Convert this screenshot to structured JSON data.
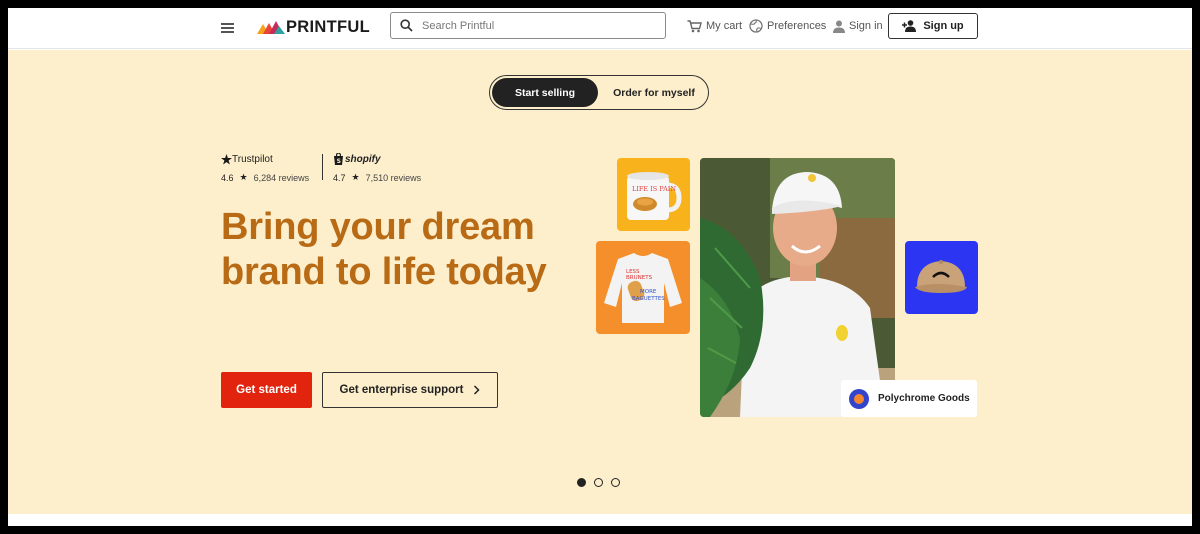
{
  "header": {
    "logo_text": "PRINTFUL",
    "search_placeholder": "Search Printful",
    "cart_label": "My cart",
    "preferences_label": "Preferences",
    "signin_label": "Sign in",
    "signup_label": "Sign up"
  },
  "hero": {
    "toggle": {
      "active": "Start selling",
      "inactive": "Order for myself"
    },
    "ratings": [
      {
        "brand": "Trustpilot",
        "score": "4.6",
        "reviews": "6,284 reviews"
      },
      {
        "brand": "shopify",
        "score": "4.7",
        "reviews": "7,510 reviews"
      }
    ],
    "headline": "Bring your dream brand to life today",
    "primary_cta": "Get started",
    "secondary_cta": "Get enterprise support",
    "badge_label": "Polychrome Goods",
    "carousel": {
      "count": 3,
      "active_index": 0
    }
  },
  "colors": {
    "hero_bg": "#fdefcc",
    "headline": "#b86a15",
    "primary_button": "#e2230e",
    "mug_tile": "#f7b21c",
    "shirt_tile": "#f58f2b",
    "hat_tile": "#2c36f2"
  },
  "icons": [
    "menu-icon",
    "search-icon",
    "cart-icon",
    "globe-icon",
    "person-icon",
    "person-add-icon",
    "star-icon",
    "shopify-bag-icon",
    "chevron-right-icon"
  ]
}
